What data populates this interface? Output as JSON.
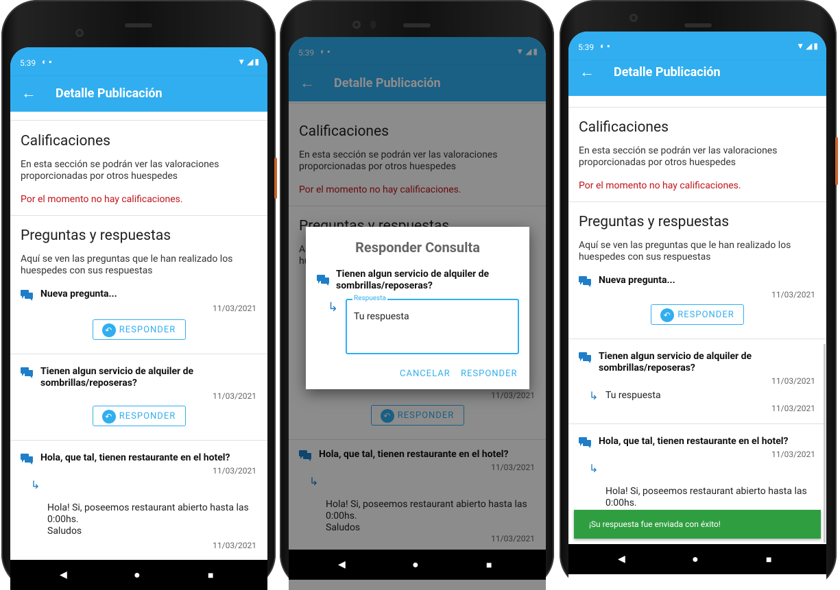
{
  "status": {
    "time": "5:39"
  },
  "appbar": {
    "title": "Detalle Publicación"
  },
  "ratings": {
    "title": "Calificaciones",
    "description": "En esta sección se podrán ver las valoraciones proporcionadas por otros huespedes",
    "empty": "Por el momento no hay calificaciones."
  },
  "qa": {
    "title": "Preguntas y respuestas",
    "description": "Aquí se ven las preguntas que le han realizado los huespedes con sus respuestas",
    "items": [
      {
        "question": "Nueva pregunta...",
        "date": "11/03/2021"
      },
      {
        "question": "Tienen algun servicio de alquiler de sombrillas/reposeras?",
        "date": "11/03/2021"
      },
      {
        "question": "Hola, que tal, tienen restaurante en el hotel?",
        "date": "11/03/2021",
        "answer": "Hola! Si, poseemos restaurant abierto hasta las 0:00hs.\nSaludos",
        "answer_date": "11/03/2021"
      }
    ],
    "new_answer": {
      "text": "Tu respuesta",
      "date": "11/03/2021"
    },
    "respond_label": "RESPONDER"
  },
  "dialog": {
    "title": "Responder Consulta",
    "question": "Tienen algun servicio de alquiler de sombrillas/reposeras?",
    "field_label": "Respuesta",
    "field_value": "Tu respuesta",
    "cancel": "CANCELAR",
    "respond": "RESPONDER"
  },
  "snackbar": {
    "text": "¡Su respuesta fue enviada con éxito!"
  },
  "colors": {
    "primary": "#30aef0",
    "error": "#c0141b",
    "success": "#2f9e41",
    "icon": "#1e7ec8"
  }
}
